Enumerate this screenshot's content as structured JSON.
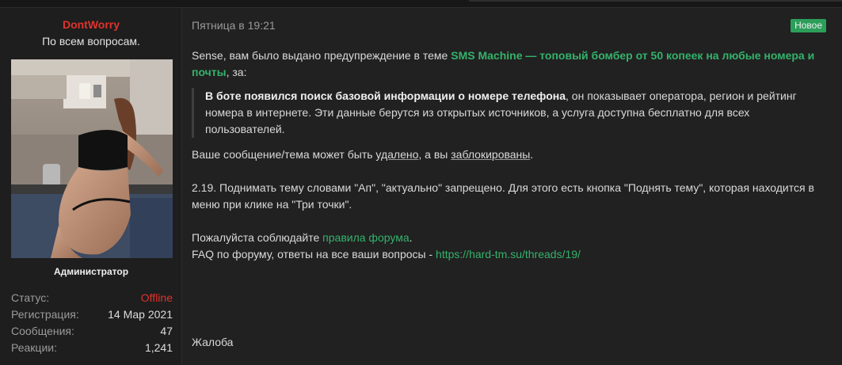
{
  "user": {
    "name": "DontWorry",
    "title": "По всем вопросам.",
    "role": "Администратор",
    "stats": [
      {
        "label": "Статус:",
        "value": "Offline"
      },
      {
        "label": "Регистрация:",
        "value": "14 Мар 2021"
      },
      {
        "label": "Сообщения:",
        "value": "47"
      },
      {
        "label": "Реакции:",
        "value": "1,241"
      }
    ]
  },
  "message": {
    "date": "Пятница в 19:21",
    "badge": "Новое",
    "intro_prefix": "Sense, вам было выдано предупреждение в теме ",
    "thread_link": "SMS Machine — топовый бомбер от 50 копеек на любые номера и почты",
    "intro_suffix": ", за:",
    "quote_bold": "В боте появился поиск базовой информации о номере телефона",
    "quote_rest": ", он показывает оператора, регион и рейтинг номера в интернете. Эти данные берутся из открытых источников, а услуга доступна бесплатно для всех пользователей.",
    "consequence_prefix": "Ваше сообщение/тема может быть ",
    "consequence_deleted": "удалено",
    "consequence_middle": ", а вы ",
    "consequence_blocked": "заблокированы",
    "consequence_suffix": ".",
    "rule_text": "2.19. Поднимать тему словами \"Ап\", \"актуально\" запрещено. Для этого есть кнопка \"Поднять тему\", которая находится в меню при клике на \"Три точки\".",
    "rules_prefix": "Пожалуйста соблюдайте ",
    "rules_link": "правила форума",
    "rules_suffix": ".",
    "faq_prefix": "FAQ по форуму, ответы на все ваши вопросы - ",
    "faq_link": "https://hard-tm.su/threads/19/",
    "complaint": "Жалоба"
  },
  "colors": {
    "username": "#e0332c",
    "link": "#34b26b",
    "badge": "#2b9e5a",
    "offline": "#e0332c"
  }
}
